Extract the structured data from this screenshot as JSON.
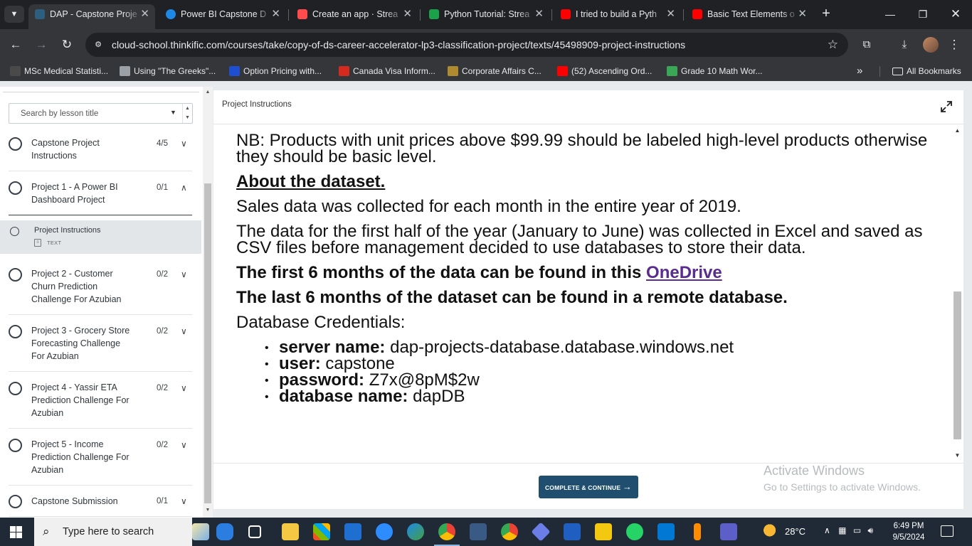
{
  "browser": {
    "tabs": [
      {
        "title": "DAP - Capstone Proje",
        "active": true,
        "favicon_color": "#2f5f80"
      },
      {
        "title": "Power BI Capstone D",
        "active": false,
        "favicon_color": "#1e88e5"
      },
      {
        "title": "Create an app · Strea",
        "active": false,
        "favicon_color": "#ff4b4b"
      },
      {
        "title": "Python Tutorial: Strea",
        "active": false,
        "favicon_color": "#1aa14a"
      },
      {
        "title": "I tried to build a Pyth",
        "active": false,
        "favicon_color": "#ff0000"
      },
      {
        "title": "Basic Text Elements o",
        "active": false,
        "favicon_color": "#ff0000"
      }
    ],
    "url": "cloud-school.thinkific.com/courses/take/copy-of-ds-career-accelerator-lp3-classification-project/texts/45498909-project-instructions",
    "bookmarks": [
      {
        "label": "MSc Medical Statisti...",
        "color": "#4a4a4a"
      },
      {
        "label": "Using \"The Greeks\"...",
        "color": "#9aa0a6"
      },
      {
        "label": "Option Pricing with...",
        "color": "#1f4fd1"
      },
      {
        "label": "Canada Visa Inform...",
        "color": "#d52b1e"
      },
      {
        "label": "Corporate Affairs C...",
        "color": "#b08a2e"
      },
      {
        "label": "(52) Ascending Ord...",
        "color": "#ff0000"
      },
      {
        "label": "Grade 10 Math Wor...",
        "color": "#3aa757"
      }
    ],
    "all_bookmarks": "All Bookmarks"
  },
  "sidebar": {
    "search_placeholder": "Search by lesson title",
    "chapters": [
      {
        "title": "Capstone Project Instructions",
        "count": "4/5",
        "expanded": false
      },
      {
        "title": "Project 1 - A Power BI Dashboard Project",
        "count": "0/1",
        "expanded": true
      },
      {
        "title": "Project 2 - Customer Churn Prediction Challenge For Azubian",
        "count": "0/2",
        "expanded": false
      },
      {
        "title": "Project 3 - Grocery Store Forecasting Challenge For Azubian",
        "count": "0/2",
        "expanded": false
      },
      {
        "title": "Project 4 - Yassir ETA Prediction Challenge For Azubian",
        "count": "0/2",
        "expanded": false
      },
      {
        "title": "Project 5 - Income Prediction Challenge For Azubian",
        "count": "0/2",
        "expanded": false
      },
      {
        "title": "Capstone Submission",
        "count": "0/1",
        "expanded": false
      }
    ],
    "active_lesson": {
      "title": "Project Instructions",
      "type": "TEXT"
    }
  },
  "main": {
    "header_title": "Project Instructions",
    "content": {
      "nb": "NB: Products with unit prices above $99.99 should be labeled high-level products otherwise they should be basic level.",
      "about_heading": "About the dataset.",
      "sales": "Sales data was collected for each month in the entire year of 2019.",
      "first_half": "The data for the first half of the year (January to June) was collected in Excel and saved as CSV files before management decided to use databases to store their data.",
      "first6_text": "The first 6 months of the data can be found in this ",
      "first6_link": "OneDrive",
      "last6": "The last 6 months of the dataset can be found in a remote database.",
      "cred_heading": "Database Credentials:",
      "credentials": [
        {
          "key": "server name:",
          "value": "dap-projects-database.database.windows.net"
        },
        {
          "key": "user:",
          "value": "capstone"
        },
        {
          "key": "password:",
          "value": "Z7x@8pM$2w"
        },
        {
          "key": "database name:",
          "value": "dapDB"
        }
      ]
    },
    "complete_button": "COMPLETE & CONTINUE",
    "activate_line1": "Activate Windows",
    "activate_line2": "Go to Settings to activate Windows."
  },
  "taskbar": {
    "search_text": "Type here to search",
    "weather": "28°C",
    "time": "6:49 PM",
    "date": "9/5/2024"
  }
}
